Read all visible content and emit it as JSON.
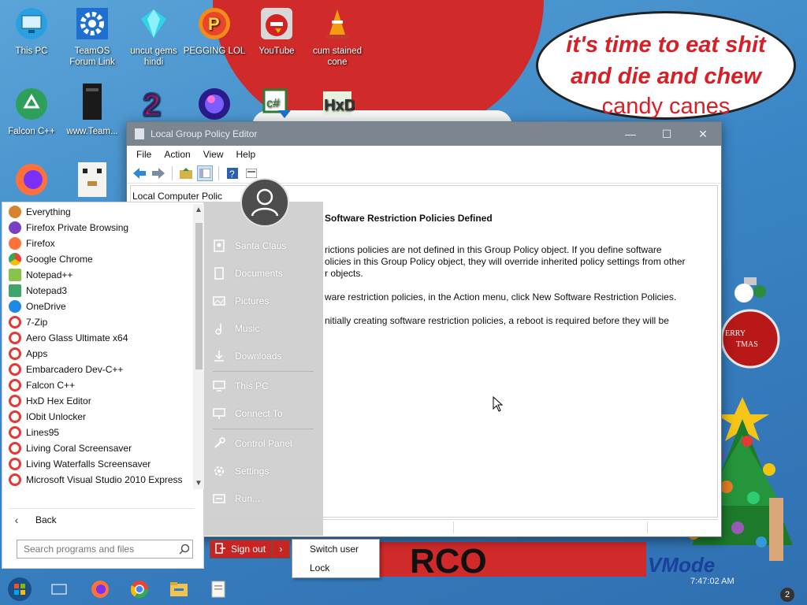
{
  "wallpaper": {
    "bubble_line1": "it's time to eat shit",
    "bubble_line2": "and die and chew",
    "bubble_line3": "candy canes",
    "bottom_text": "RCO",
    "brand_text": "VMode",
    "ornament_text": "ERRY\nTMAS",
    "clock_text": "7:47:02 AM",
    "badge_number": "2"
  },
  "desktop_icons": [
    {
      "label": "This PC",
      "icon": "monitor-icon"
    },
    {
      "label": "TeamOS Forum Link",
      "icon": "gear-icon"
    },
    {
      "label": "uncut gems hindi",
      "icon": "diamond-icon"
    },
    {
      "label": "PEGGING LOL",
      "icon": "peggle-icon"
    },
    {
      "label": "YouTube",
      "icon": "angry-bird-icon"
    },
    {
      "label": "cum stained cone",
      "icon": "traffic-cone-icon"
    },
    {
      "label": "Falcon C++",
      "icon": "recycle-icon"
    },
    {
      "label": "www.Team...",
      "icon": "book-icon"
    },
    {
      "label": "",
      "icon": "number-2-icon"
    },
    {
      "label": "",
      "icon": "orb-icon"
    },
    {
      "label": "",
      "icon": "csharp-icon"
    },
    {
      "label": "",
      "icon": "hxd-icon"
    },
    {
      "label": "",
      "icon": "firefox-icon"
    },
    {
      "label": "",
      "icon": "pixel-cat-icon"
    }
  ],
  "gp_window": {
    "title": "Local Group Policy Editor",
    "menus": [
      "File",
      "Action",
      "View",
      "Help"
    ],
    "tree_stub": "Local Computer Polic",
    "heading": "Software Restriction Policies Defined",
    "para1_line1": "rictions policies are not defined in this Group Policy object. If you define software",
    "para1_line2": "olicies in this Group Policy object, they will override inherited policy settings from other",
    "para1_line3": "r objects.",
    "para2": "ware restriction policies, in the Action menu, click New Software Restriction Policies.",
    "para3": "nitially creating software restriction policies, a reboot is required before they will be"
  },
  "start_menu": {
    "programs": [
      {
        "label": "Everything",
        "color": "#d9822b"
      },
      {
        "label": "Firefox Private Browsing",
        "color": "#7a3fc4"
      },
      {
        "label": "Firefox",
        "color": "#ff7139"
      },
      {
        "label": "Google Chrome",
        "color": "#34a853"
      },
      {
        "label": "Notepad++",
        "color": "#8bc34a"
      },
      {
        "label": "Notepad3",
        "color": "#3fa66a"
      },
      {
        "label": "OneDrive",
        "color": "#1e88e5"
      },
      {
        "label": "7-Zip",
        "color": "#e53935"
      },
      {
        "label": "Aero Glass Ultimate x64",
        "color": "#e53935"
      },
      {
        "label": "Apps",
        "color": "#e53935"
      },
      {
        "label": "Embarcadero Dev-C++",
        "color": "#e53935"
      },
      {
        "label": "Falcon C++",
        "color": "#e53935"
      },
      {
        "label": "HxD Hex Editor",
        "color": "#e53935"
      },
      {
        "label": "IObit Unlocker",
        "color": "#e53935"
      },
      {
        "label": "Lines95",
        "color": "#e53935"
      },
      {
        "label": "Living Coral Screensaver",
        "color": "#e53935"
      },
      {
        "label": "Living Waterfalls Screensaver",
        "color": "#e53935"
      },
      {
        "label": "Microsoft Visual Studio 2010 Express",
        "color": "#e53935"
      }
    ],
    "back_label": "Back",
    "search_placeholder": "Search programs and files",
    "places": [
      {
        "label": "Santa Claus",
        "icon": "user-folder-icon"
      },
      {
        "label": "Documents",
        "icon": "document-icon"
      },
      {
        "label": "Pictures",
        "icon": "picture-icon"
      },
      {
        "label": "Music",
        "icon": "music-icon"
      },
      {
        "label": "Downloads",
        "icon": "download-icon"
      },
      {
        "label": "This PC",
        "icon": "computer-icon"
      },
      {
        "label": "Connect To",
        "icon": "network-icon"
      },
      {
        "label": "Control Panel",
        "icon": "wrench-icon"
      },
      {
        "label": "Settings",
        "icon": "gear-icon"
      },
      {
        "label": "Run...",
        "icon": "run-icon"
      }
    ],
    "signout_label": "Sign out",
    "flyout": [
      "Switch user",
      "Lock"
    ]
  },
  "taskbar": {
    "items": [
      "start-orb-icon",
      "task-view-icon",
      "firefox-icon",
      "chrome-icon",
      "file-explorer-icon",
      "notepad-icon"
    ]
  }
}
